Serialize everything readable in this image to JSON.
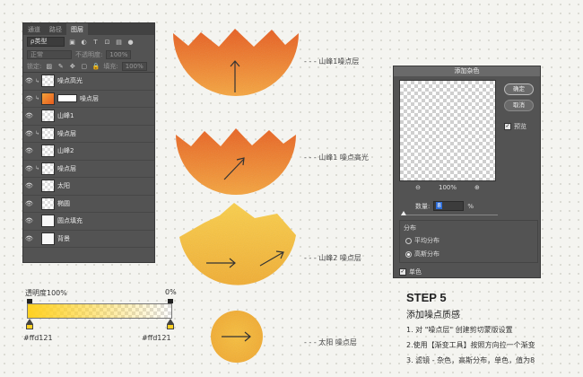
{
  "layers_panel": {
    "tabs": [
      "通道",
      "路径",
      "图层"
    ],
    "filter_label": "ρ类型",
    "blend_mode": "正常",
    "opacity_label": "不透明度:",
    "opacity_value": "100%",
    "lock_label": "锁定:",
    "fill_label": "填充:",
    "fill_value": "100%",
    "layers": [
      {
        "name": "噪点高光",
        "thumb": "transparent",
        "clipped": true,
        "mask": false
      },
      {
        "name": "噪点层",
        "thumb": "orange",
        "clipped": true,
        "mask": true
      },
      {
        "name": "山峰1",
        "thumb": "transparent",
        "clipped": false,
        "mask": false
      },
      {
        "name": "噪点层",
        "thumb": "transparent",
        "clipped": true,
        "mask": false
      },
      {
        "name": "山峰2",
        "thumb": "transparent",
        "clipped": false,
        "mask": false
      },
      {
        "name": "噪点层",
        "thumb": "transparent",
        "clipped": true,
        "mask": false
      },
      {
        "name": "太阳",
        "thumb": "transparent",
        "clipped": false,
        "mask": false
      },
      {
        "name": "椭圆",
        "thumb": "transparent",
        "clipped": false,
        "mask": false
      },
      {
        "name": "圆点填充",
        "thumb": "plain",
        "clipped": false,
        "mask": false
      },
      {
        "name": "背景",
        "thumb": "plain",
        "clipped": false,
        "mask": false
      }
    ]
  },
  "shape_labels": {
    "mountain1_noise": "山峰1噪点层",
    "mountain1_highlight": "山峰1 噪点高光",
    "mountain2_noise": "山峰2 噪点层",
    "sun_noise": "太阳 噪点层",
    "dash": "- - -"
  },
  "gradient": {
    "opacity_label": "透明度100%",
    "opacity_right": "0%",
    "left_hex": "#ffd121",
    "right_hex": "#ffd121",
    "color": "#ffd121"
  },
  "noise_dialog": {
    "title": "添加杂色",
    "ok_label": "确定",
    "cancel_label": "取消",
    "preview_label": "预览",
    "zoom_value": "100%",
    "amount_label": "数量:",
    "amount_value": "8",
    "amount_unit": "%",
    "distribution_label": "分布",
    "uniform_label": "平均分布",
    "gaussian_label": "高斯分布",
    "mono_label": "单色"
  },
  "step": {
    "title": "STEP 5",
    "subtitle": "添加噪点质感",
    "line1": "1. 对 \"噪点层\" 创建剪切蒙版设置",
    "line2": "2.使用【渐变工具】按照方向拉一个渐变",
    "line3": "3. 滤镜 - 杂色，高斯分布，单色，值为8"
  },
  "colors": {
    "orange_dark": "#e85b1d",
    "orange_light": "#f7a53c",
    "yellow": "#f6bb35",
    "yellow_light": "#fbd04a"
  }
}
